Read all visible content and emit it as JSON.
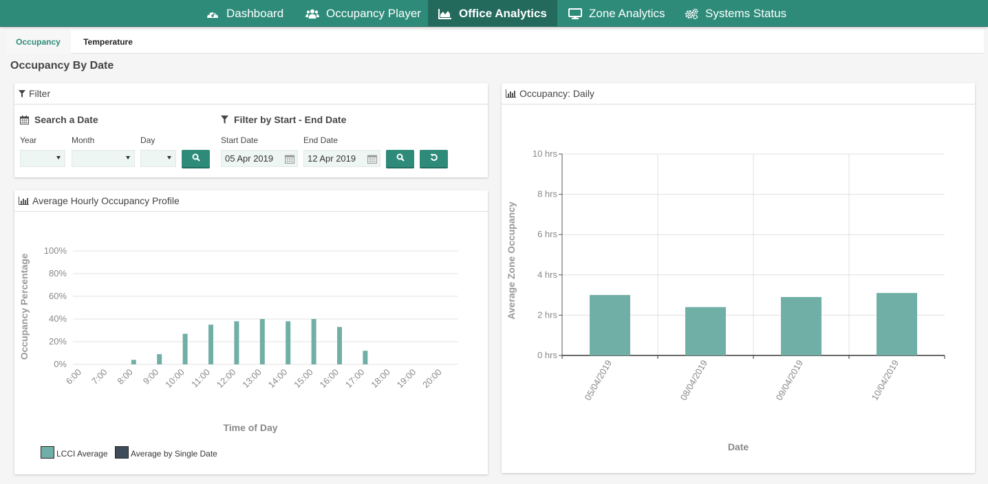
{
  "nav": {
    "items": [
      {
        "label": "Dashboard",
        "icon": "dashboard-icon"
      },
      {
        "label": "Occupancy Player",
        "icon": "users-icon"
      },
      {
        "label": "Office Analytics",
        "icon": "area-chart-icon",
        "active": true
      },
      {
        "label": "Zone Analytics",
        "icon": "desktop-icon"
      },
      {
        "label": "Systems Status",
        "icon": "gears-icon"
      }
    ]
  },
  "subtabs": [
    {
      "label": "Occupancy",
      "active": true
    },
    {
      "label": "Temperature",
      "active": false
    }
  ],
  "page_title": "Occupancy By Date",
  "filter": {
    "title": "Filter",
    "search_title": "Search a Date",
    "year_label": "Year",
    "month_label": "Month",
    "day_label": "Day",
    "range_title": "Filter by Start - End Date",
    "start_label": "Start Date",
    "start_value": "05 Apr 2019",
    "end_label": "End Date",
    "end_value": "12 Apr 2019"
  },
  "hourly_panel": {
    "title": "Average Hourly Occupancy Profile",
    "legend": [
      {
        "label": "LCCI Average",
        "color": "#6fafa5"
      },
      {
        "label": "Average by Single Date",
        "color": "#3e4c5a"
      }
    ]
  },
  "daily_panel": {
    "title": "Occupancy: Daily"
  },
  "colors": {
    "accent": "#2e8b7a",
    "bar": "#6fafa5"
  },
  "chart_data": [
    {
      "type": "bar",
      "xlabel": "Time of Day",
      "ylabel": "Occupancy Percentage",
      "categories": [
        "6:00",
        "7:00",
        "8:00",
        "9:00",
        "10:00",
        "11:00",
        "12:00",
        "13:00",
        "14:00",
        "15:00",
        "16:00",
        "17:00",
        "18:00",
        "19:00",
        "20:00"
      ],
      "yticks": [
        "0%",
        "20%",
        "40%",
        "60%",
        "80%",
        "100%"
      ],
      "ylim": [
        0,
        100
      ],
      "series": [
        {
          "name": "LCCI Average",
          "values": [
            0,
            0,
            4,
            9,
            27,
            35,
            38,
            40,
            38,
            40,
            33,
            12,
            0,
            0,
            0
          ]
        }
      ],
      "grid": "horizontal"
    },
    {
      "type": "bar",
      "xlabel": "Date",
      "ylabel": "Average Zone Occupancy",
      "categories": [
        "05/04/2019",
        "08/04/2019",
        "09/04/2019",
        "10/04/2019"
      ],
      "yticks": [
        "0 hrs",
        "2 hrs",
        "4 hrs",
        "6 hrs",
        "8 hrs",
        "10 hrs"
      ],
      "ylim": [
        0,
        10
      ],
      "values": [
        3.0,
        2.4,
        2.9,
        3.1
      ],
      "grid": "both"
    }
  ]
}
